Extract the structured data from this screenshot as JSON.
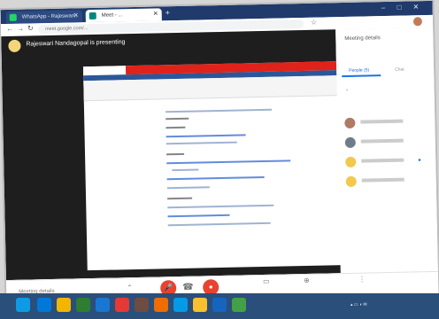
{
  "browser": {
    "tabs": [
      {
        "label": "WhatsApp - Rajeswari..",
        "active": false
      },
      {
        "label": "Meet - ...",
        "active": true
      }
    ],
    "new_tab": "+",
    "url": "meet.google.com/...",
    "window_controls": [
      "–",
      "□",
      "✕"
    ]
  },
  "presentation": {
    "presenter_name": "Rajeswari Nandagopal is presenting"
  },
  "people_panel": {
    "title": "Meeting details",
    "tabs": {
      "people": "People (5)",
      "chat": "Chat"
    }
  },
  "controls": {
    "meeting_details": "Meeting details",
    "hang_up": "☎",
    "mic": "🎤",
    "camera": "●"
  },
  "colors": {
    "tabbar": "#1f3a6b",
    "red_accent": "#e8432f",
    "taskbar": "#2a4f7a"
  }
}
